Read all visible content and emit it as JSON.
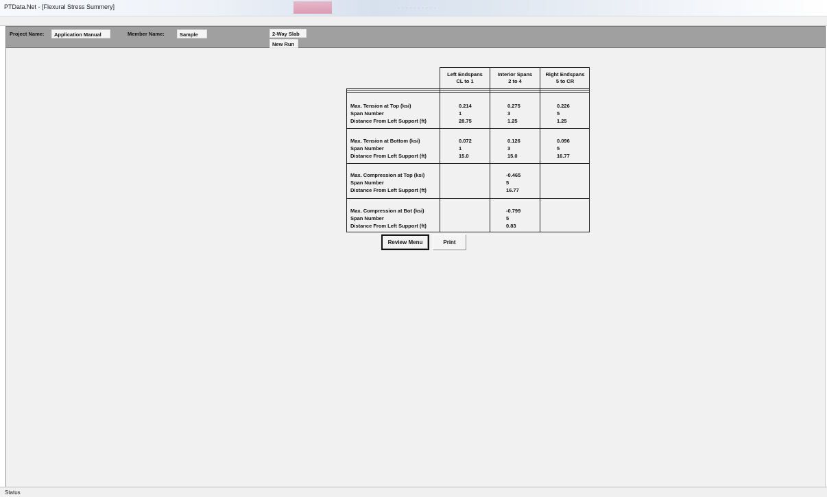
{
  "window": {
    "title": "PTData.Net - [Flexural Stress Summery]"
  },
  "header": {
    "project_label": "Project Name:",
    "project_value": "Application Manual",
    "member_label": "Member Name:",
    "member_value": "Sample",
    "slab_type": "2-Way Slab",
    "run_type": "New Run"
  },
  "table": {
    "columns": [
      {
        "title": "Left Endspans",
        "range": "CL  to 1"
      },
      {
        "title": "Interior Spans",
        "range": "2   to 4"
      },
      {
        "title": "Right Endspans",
        "range": "5   to CR"
      }
    ],
    "groups": [
      {
        "labels": [
          "Max. Tension at Top (ksi)",
          "Span Number",
          "Distance From Left Support (ft)"
        ],
        "values": [
          [
            "0.214",
            "1",
            "28.75"
          ],
          [
            "0.275",
            "3",
            "1.25"
          ],
          [
            "0.226",
            "5",
            "1.25"
          ]
        ]
      },
      {
        "labels": [
          "Max. Tension at Bottom (ksi)",
          "Span Number",
          "Distance From Left Support (ft)"
        ],
        "values": [
          [
            "0.072",
            "1",
            "15.0"
          ],
          [
            "0.126",
            "3",
            "15.0"
          ],
          [
            "0.096",
            "5",
            "16.77"
          ]
        ]
      },
      {
        "labels": [
          "Max. Compression at Top (ksi)",
          "Span Number",
          "Distance From Left Support (ft)"
        ],
        "values": [
          [
            "",
            "",
            ""
          ],
          [
            "-0.465",
            "5",
            "16.77"
          ],
          [
            "",
            "",
            ""
          ]
        ]
      },
      {
        "labels": [
          "Max. Compression at Bot (ksi)",
          "Span Number",
          "Distance From Left Support (ft)"
        ],
        "values": [
          [
            "",
            "",
            ""
          ],
          [
            "-0.799",
            "5",
            "0.83"
          ],
          [
            "",
            "",
            ""
          ]
        ]
      }
    ]
  },
  "buttons": {
    "review_menu": "Review Menu",
    "print": "Print"
  },
  "status": {
    "text": "Status"
  }
}
